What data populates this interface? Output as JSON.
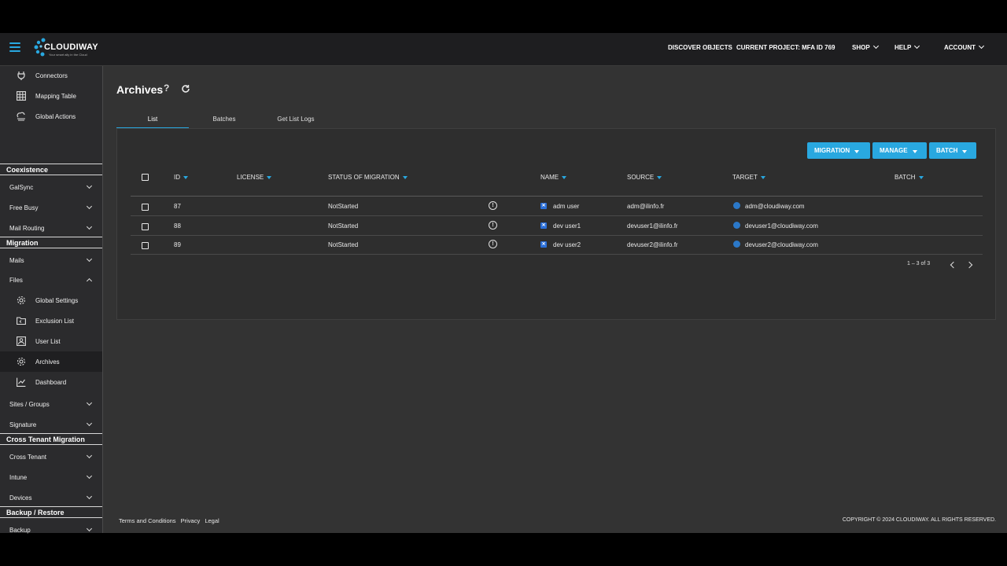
{
  "brand": {
    "name": "CLOUDIWAY",
    "tagline": "Your smart ally in the Cloud"
  },
  "topnav": {
    "discover": "DISCOVER OBJECTS",
    "project": "CURRENT PROJECT: MFA ID 769",
    "shop": "SHOP",
    "help": "HELP",
    "account": "ACCOUNT"
  },
  "sidebar": {
    "connectors": "Connectors",
    "mapping_table": "Mapping Table",
    "global_actions": "Global Actions",
    "coexistence": "Coexistence",
    "galsync": "GalSync",
    "free_busy": "Free Busy",
    "mail_routing": "Mail Routing",
    "migration": "Migration",
    "mails": "Mails",
    "files": "Files",
    "global_settings": "Global Settings",
    "exclusion_list": "Exclusion List",
    "user_list": "User List",
    "archives": "Archives",
    "dashboard": "Dashboard",
    "sites_groups": "Sites / Groups",
    "signature": "Signature",
    "cross_tenant_migration": "Cross Tenant Migration",
    "cross_tenant": "Cross Tenant",
    "intune": "Intune",
    "devices": "Devices",
    "backup_restore": "Backup / Restore",
    "backup": "Backup"
  },
  "page": {
    "title": "Archives",
    "tabs": [
      "List",
      "Batches",
      "Get List Logs"
    ]
  },
  "actions": {
    "migration": "MIGRATION",
    "manage": "MANAGE",
    "batch": "BATCH"
  },
  "table": {
    "headers": {
      "id": "ID",
      "license": "LICENSE",
      "status": "STATUS OF MIGRATION",
      "name": "NAME",
      "source": "SOURCE",
      "target": "TARGET",
      "batch": "BATCH"
    },
    "rows": [
      {
        "id": "87",
        "status": "NotStarted",
        "name": "adm user",
        "source": "adm@ilinfo.fr",
        "target": "adm@cloudiway.com"
      },
      {
        "id": "88",
        "status": "NotStarted",
        "name": "dev user1",
        "source": "devuser1@ilinfo.fr",
        "target": "devuser1@cloudiway.com"
      },
      {
        "id": "89",
        "status": "NotStarted",
        "name": "dev user2",
        "source": "devuser2@ilinfo.fr",
        "target": "devuser2@cloudiway.com"
      }
    ],
    "pager": "1 – 3 of 3"
  },
  "footer": {
    "terms": "Terms and Conditions",
    "privacy": "Privacy",
    "legal": "Legal",
    "copyright": "COPYRIGHT © 2024 CLOUDIWAY. ALL RIGHTS RESERVED."
  },
  "colors": {
    "accent": "#29a8e0",
    "background": "#333333",
    "sidebar": "#2b2b2d",
    "topbar": "#1e1e20"
  }
}
